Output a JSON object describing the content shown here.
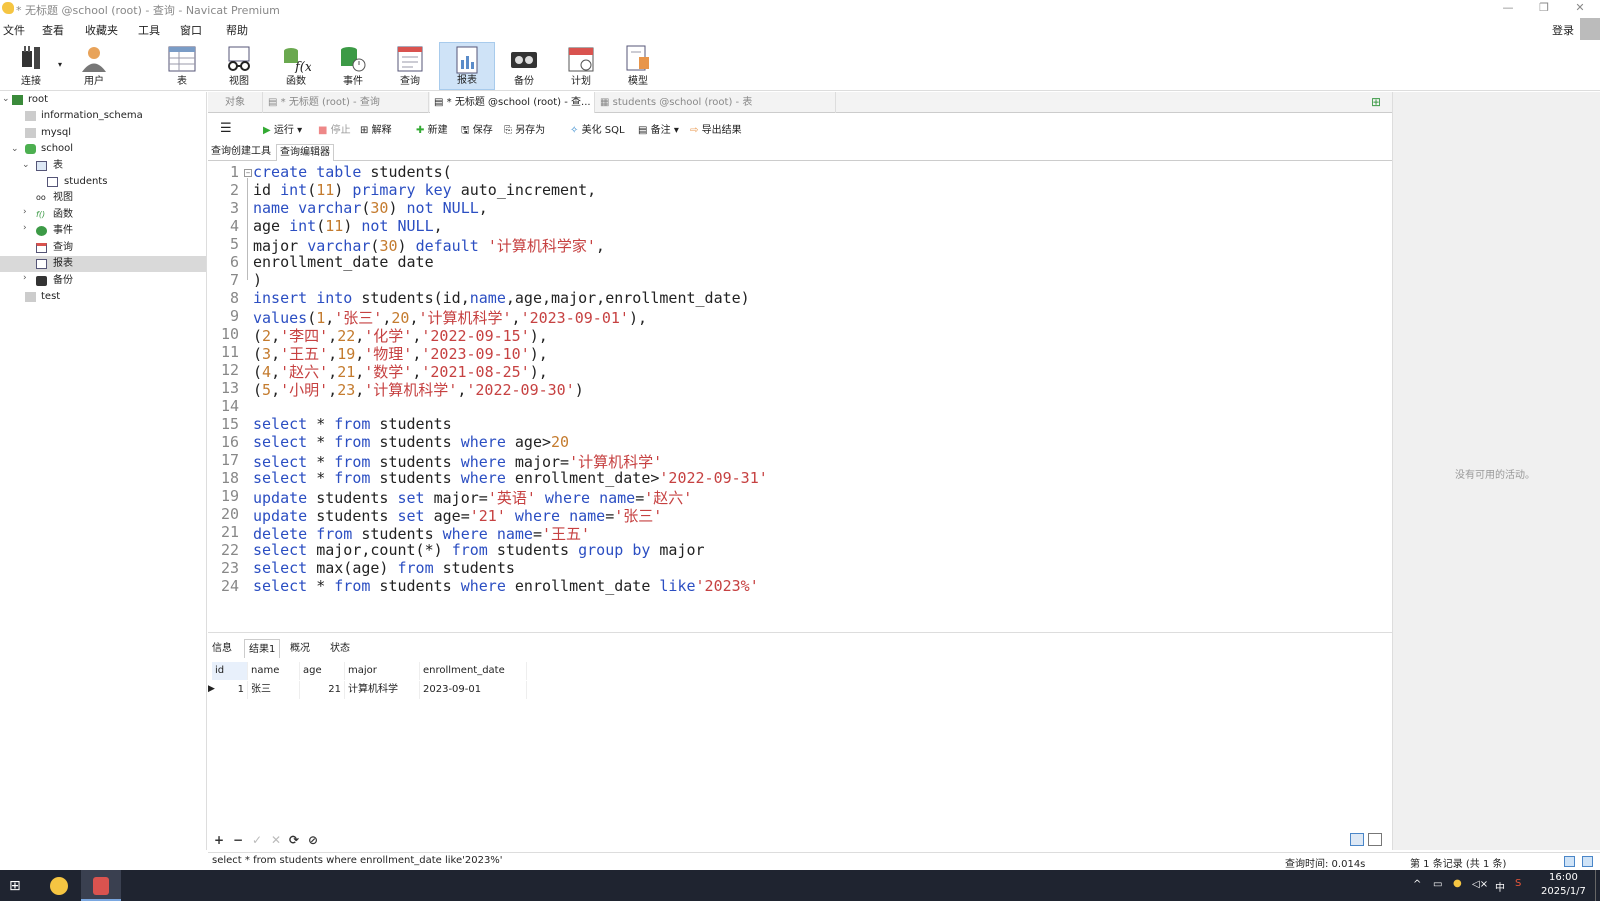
{
  "window": {
    "title": "* 无标题 @school (root) - 查询 - Navicat Premium"
  },
  "menu": [
    "文件",
    "查看",
    "收藏夹",
    "工具",
    "窗口",
    "帮助"
  ],
  "login_label": "登录",
  "toolbar": [
    {
      "label": "连接",
      "icon": "plug-icon"
    },
    {
      "label": "用户",
      "icon": "user-icon"
    },
    {
      "label": "表",
      "icon": "table-icon"
    },
    {
      "label": "视图",
      "icon": "view-icon"
    },
    {
      "label": "函数",
      "icon": "function-icon"
    },
    {
      "label": "事件",
      "icon": "event-icon"
    },
    {
      "label": "查询",
      "icon": "query-icon"
    },
    {
      "label": "报表",
      "icon": "report-icon"
    },
    {
      "label": "备份",
      "icon": "backup-icon"
    },
    {
      "label": "计划",
      "icon": "schedule-icon"
    },
    {
      "label": "模型",
      "icon": "model-icon"
    }
  ],
  "tree": [
    {
      "label": "root"
    },
    {
      "label": "information_schema"
    },
    {
      "label": "mysql"
    },
    {
      "label": "school"
    },
    {
      "label": "表"
    },
    {
      "label": "students"
    },
    {
      "label": "视图"
    },
    {
      "label": "函数"
    },
    {
      "label": "事件"
    },
    {
      "label": "查询"
    },
    {
      "label": "报表"
    },
    {
      "label": "备份"
    },
    {
      "label": "test"
    }
  ],
  "tabs": [
    "对象",
    "* 无标题 (root) - 查询",
    "* 无标题 @school (root) - 查...",
    "students @school (root) - 表"
  ],
  "query_toolbar": {
    "run": "运行",
    "stop": "停止",
    "explain": "解释",
    "new": "新建",
    "save": "保存",
    "save_as": "另存为",
    "beautify": "美化 SQL",
    "comment": "备注",
    "export": "导出结果"
  },
  "subtabs": [
    "查询创建工具",
    "查询编辑器"
  ],
  "code_lines": [
    "1",
    "2",
    "3",
    "4",
    "5",
    "6",
    "7",
    "8",
    "9",
    "10",
    "11",
    "12",
    "13",
    "14",
    "15",
    "16",
    "17",
    "18",
    "19",
    "20",
    "21",
    "22",
    "23",
    "24"
  ],
  "result_tabs": [
    "信息",
    "结果1",
    "概况",
    "状态"
  ],
  "result": {
    "columns": [
      "id",
      "name",
      "age",
      "major",
      "enrollment_date"
    ],
    "row": [
      "1",
      "张三",
      "21",
      "计算机科学",
      "2023-09-01"
    ]
  },
  "grid_buttons": [
    "+",
    "−",
    "✓",
    "✕",
    "⟳",
    "⊘"
  ],
  "status": {
    "sql": "select * from students where enrollment_date like'2023%'",
    "query_time": "查询时间: 0.014s",
    "records": "第 1 条记录 (共 1 条)"
  },
  "right_panel": {
    "text": "没有可用的活动。"
  },
  "taskbar": {
    "time": "16:00",
    "date": "2025/1/7",
    "ime": "中"
  },
  "colors": {
    "keyword": "#2b4ec2",
    "string": "#c64141",
    "number": "#c47b2e",
    "active_tab": "#cfe3f7"
  }
}
